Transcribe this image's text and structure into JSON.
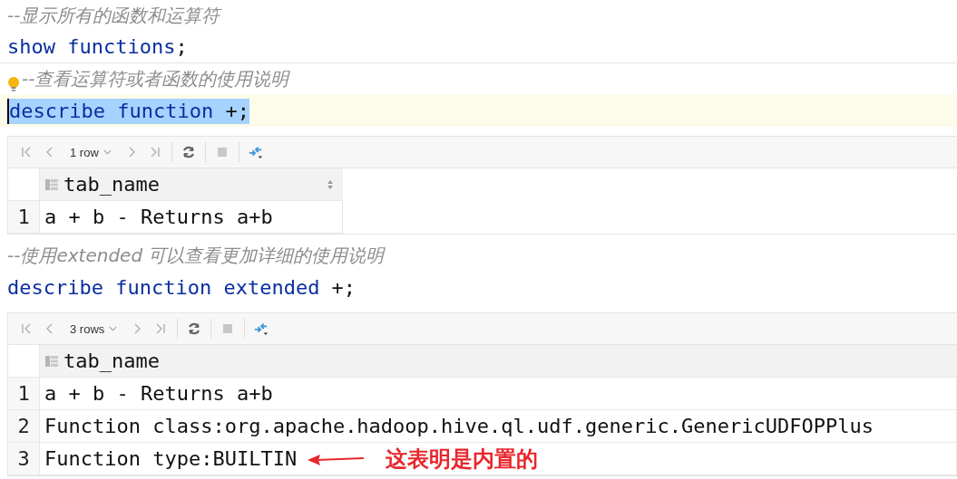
{
  "blocks": [
    {
      "kind": "comment",
      "text": "--显示所有的函数和运算符"
    },
    {
      "kind": "code",
      "current": false,
      "selected": false,
      "separator": true,
      "parts": [
        {
          "text": "show functions",
          "kind": "keyword"
        },
        {
          "text": ";",
          "kind": "plain"
        }
      ]
    },
    {
      "kind": "comment",
      "text": "--查看运算符或者函数的使用说明",
      "hint": true
    },
    {
      "kind": "code",
      "current": true,
      "selected": true,
      "separator": false,
      "parts": [
        {
          "text": "describe function",
          "kind": "keyword"
        },
        {
          "text": " +;",
          "kind": "plain"
        }
      ]
    },
    {
      "kind": "result",
      "row_count": "1 row",
      "full": false,
      "columns": [
        "tab_name"
      ],
      "sortable": true,
      "rows": [
        {
          "num": "1",
          "cells": [
            "a + b - Returns a+b"
          ]
        }
      ]
    },
    {
      "kind": "comment",
      "text": "--使用extended 可以查看更加详细的使用说明"
    },
    {
      "kind": "code",
      "current": false,
      "selected": false,
      "separator": false,
      "parts": [
        {
          "text": "describe function extended",
          "kind": "keyword"
        },
        {
          "text": " +;",
          "kind": "plain"
        }
      ]
    },
    {
      "kind": "result",
      "row_count": "3 rows",
      "full": true,
      "columns": [
        "tab_name"
      ],
      "sortable": false,
      "rows": [
        {
          "num": "1",
          "cells": [
            "a + b - Returns a+b"
          ]
        },
        {
          "num": "2",
          "cells": [
            "Function class:org.apache.hadoop.hive.ql.udf.generic.GenericUDFOPPlus"
          ]
        },
        {
          "num": "3",
          "cells": [
            "Function type:BUILTIN"
          ],
          "note": "这表明是内置的"
        }
      ]
    }
  ]
}
